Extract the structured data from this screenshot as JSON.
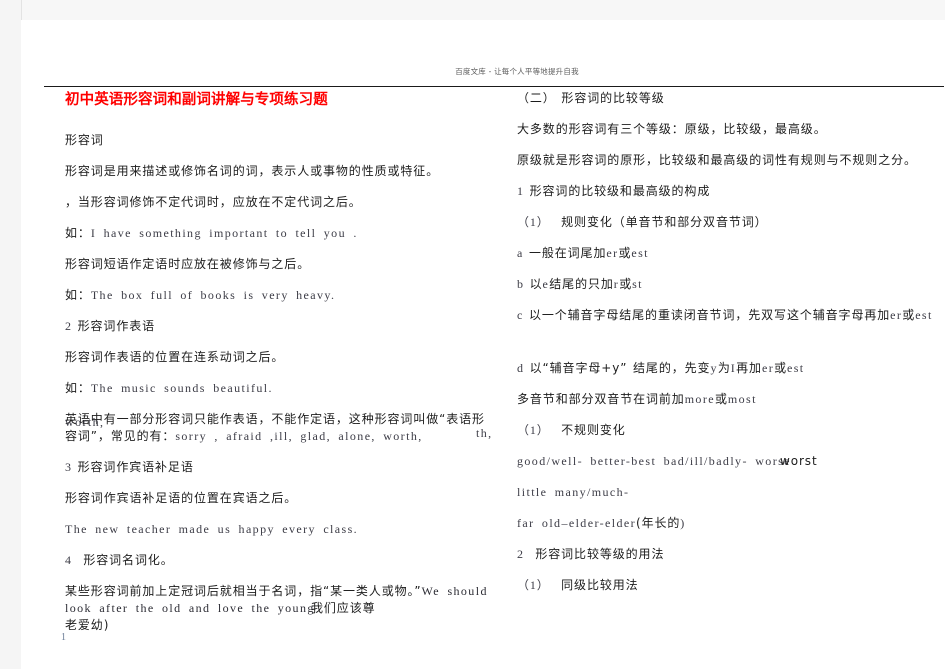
{
  "document": {
    "title": "初中英语形容词和副词讲解与专项练习题",
    "watermark": "百度文库 - 让每个人平等地提升自我",
    "page_number": "1"
  },
  "left_column": {
    "heading_adjective": "形容词",
    "p1": "形容词是用来描述或修饰名词的词，表示人或事物的性质或特征。",
    "p2": "，当形容词修饰不定代词时，应放在不定代词之后。",
    "p3_label": "如：",
    "p3_en": "I have something important to tell you .",
    "p4": "形容词短语作定语时应放在被修饰与之后。",
    "p5_label": "如：",
    "p5_en": "The box full of books is very heavy.",
    "p6_num": "2",
    "p6": "形容词作表语",
    "p7": "形容词作表语的位置在连系动词之后。",
    "p8_label": "如：",
    "p8_en": "The music sounds beautiful.",
    "p9_cn": "英语中有一部分形容词只能作表语，不能作定语，这种形容词叫做“表语形容词”，常见的有：",
    "p9_en": "sorry , afraid ,ill, glad, alone, worth,",
    "p10_num": "3",
    "p10": "形容词作宾语补足语",
    "p11": "形容词作宾语补足语的位置在宾语之后。",
    "p12_en": "The new teacher made us happy every class.",
    "p13_num": "4",
    "p13": "形容词名词化。",
    "p14_cn_a": "某些形容词前加上定冠词后就相当于名词，指“某一类人或物。”",
    "p14_en": "We should look after the old and love the young",
    "p14_cn_overlap": "我们应该尊",
    "p14_cn_tail": "老爱幼)",
    "bleed_en": "worth,"
  },
  "right_column": {
    "h1": "（二） 形容词的比较等级",
    "p1": "大多数的形容词有三个等级：原级，比较级，最高级。",
    "p2": "原级就是形容词的原形，比较级和最高级的词性有规则与不规则之分。",
    "p3_num": "1",
    "p3": "形容词的比较级和最高级的构成",
    "p4_num": "（1）",
    "p4": "规则变化（单音节和部分双音节词）",
    "p5_num": "a",
    "p5_cn_a": "一般在词尾加",
    "p5_en_a": "er",
    "p5_cn_b": "或",
    "p5_en_b": "est",
    "p6_num": "b",
    "p6_cn_a": "以",
    "p6_en_a": "e",
    "p6_cn_b": "结尾的只加",
    "p6_en_b": "r",
    "p6_cn_c": "或",
    "p6_en_c": "st",
    "p7_num": "c",
    "p7_cn_a": "以一个辅音字母结尾的重读闭音节词，先双写这个辅音字母再加",
    "p7_en_a": "er",
    "p7_cn_b": "或",
    "p7_en_b": "est",
    "p8_num": "d",
    "p8_cn_a": "以“辅音字母+y” 结尾的，先变",
    "p8_en_a": "y",
    "p8_cn_b": "为",
    "p8_en_b": "I",
    "p8_cn_c": "再加",
    "p8_en_c": "er",
    "p8_cn_d": "或",
    "p8_en_d": "est",
    "p9_cn_a": "多音节和部分双音节在词前加",
    "p9_en_a": "more",
    "p9_cn_b": "或",
    "p9_en_b": "most",
    "p10_num": "（1）",
    "p10": "不规则变化",
    "p11_en": "good/well-  better-best  bad/ill/badly-  worse",
    "p11_en_overlap": "worst",
    "p12_en": "little  many/much-",
    "p13_en": "far  old–elder-elder",
    "p13_cn": "(年长的",
    "p13_tail": ")",
    "p14_num": "2",
    "p14": "形容词比较等级的用法",
    "p15_num": "（1）",
    "p15": "同级比较用法",
    "bleed_left": "th,"
  }
}
